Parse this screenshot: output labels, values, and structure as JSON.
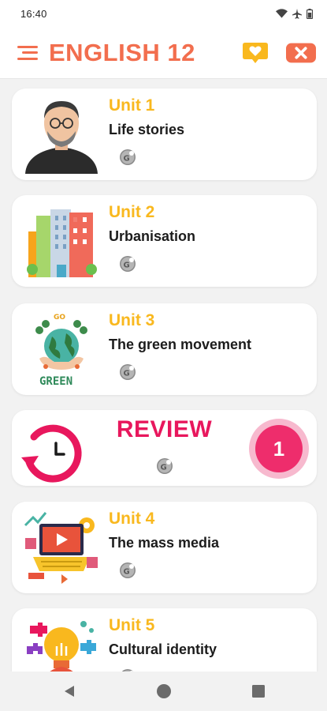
{
  "status_bar": {
    "time": "16:40"
  },
  "app_bar": {
    "title": "ENGLISH 12"
  },
  "units": [
    {
      "unit": "Unit 1",
      "name": "Life stories"
    },
    {
      "unit": "Unit 2",
      "name": "Urbanisation"
    },
    {
      "unit": "Unit 3",
      "name": "The green movement",
      "thumb_text": "GREEN",
      "thumb_small": "GO"
    },
    {
      "unit": "Unit 4",
      "name": "The mass media"
    },
    {
      "unit": "Unit 5",
      "name": "Cultural identity"
    }
  ],
  "review": {
    "title": "REVIEW",
    "count": "1"
  },
  "colors": {
    "accent": "#f26e4e",
    "unit_label": "#f9b81e",
    "review": "#e8175d",
    "action_yellow": "#f9b81e"
  }
}
